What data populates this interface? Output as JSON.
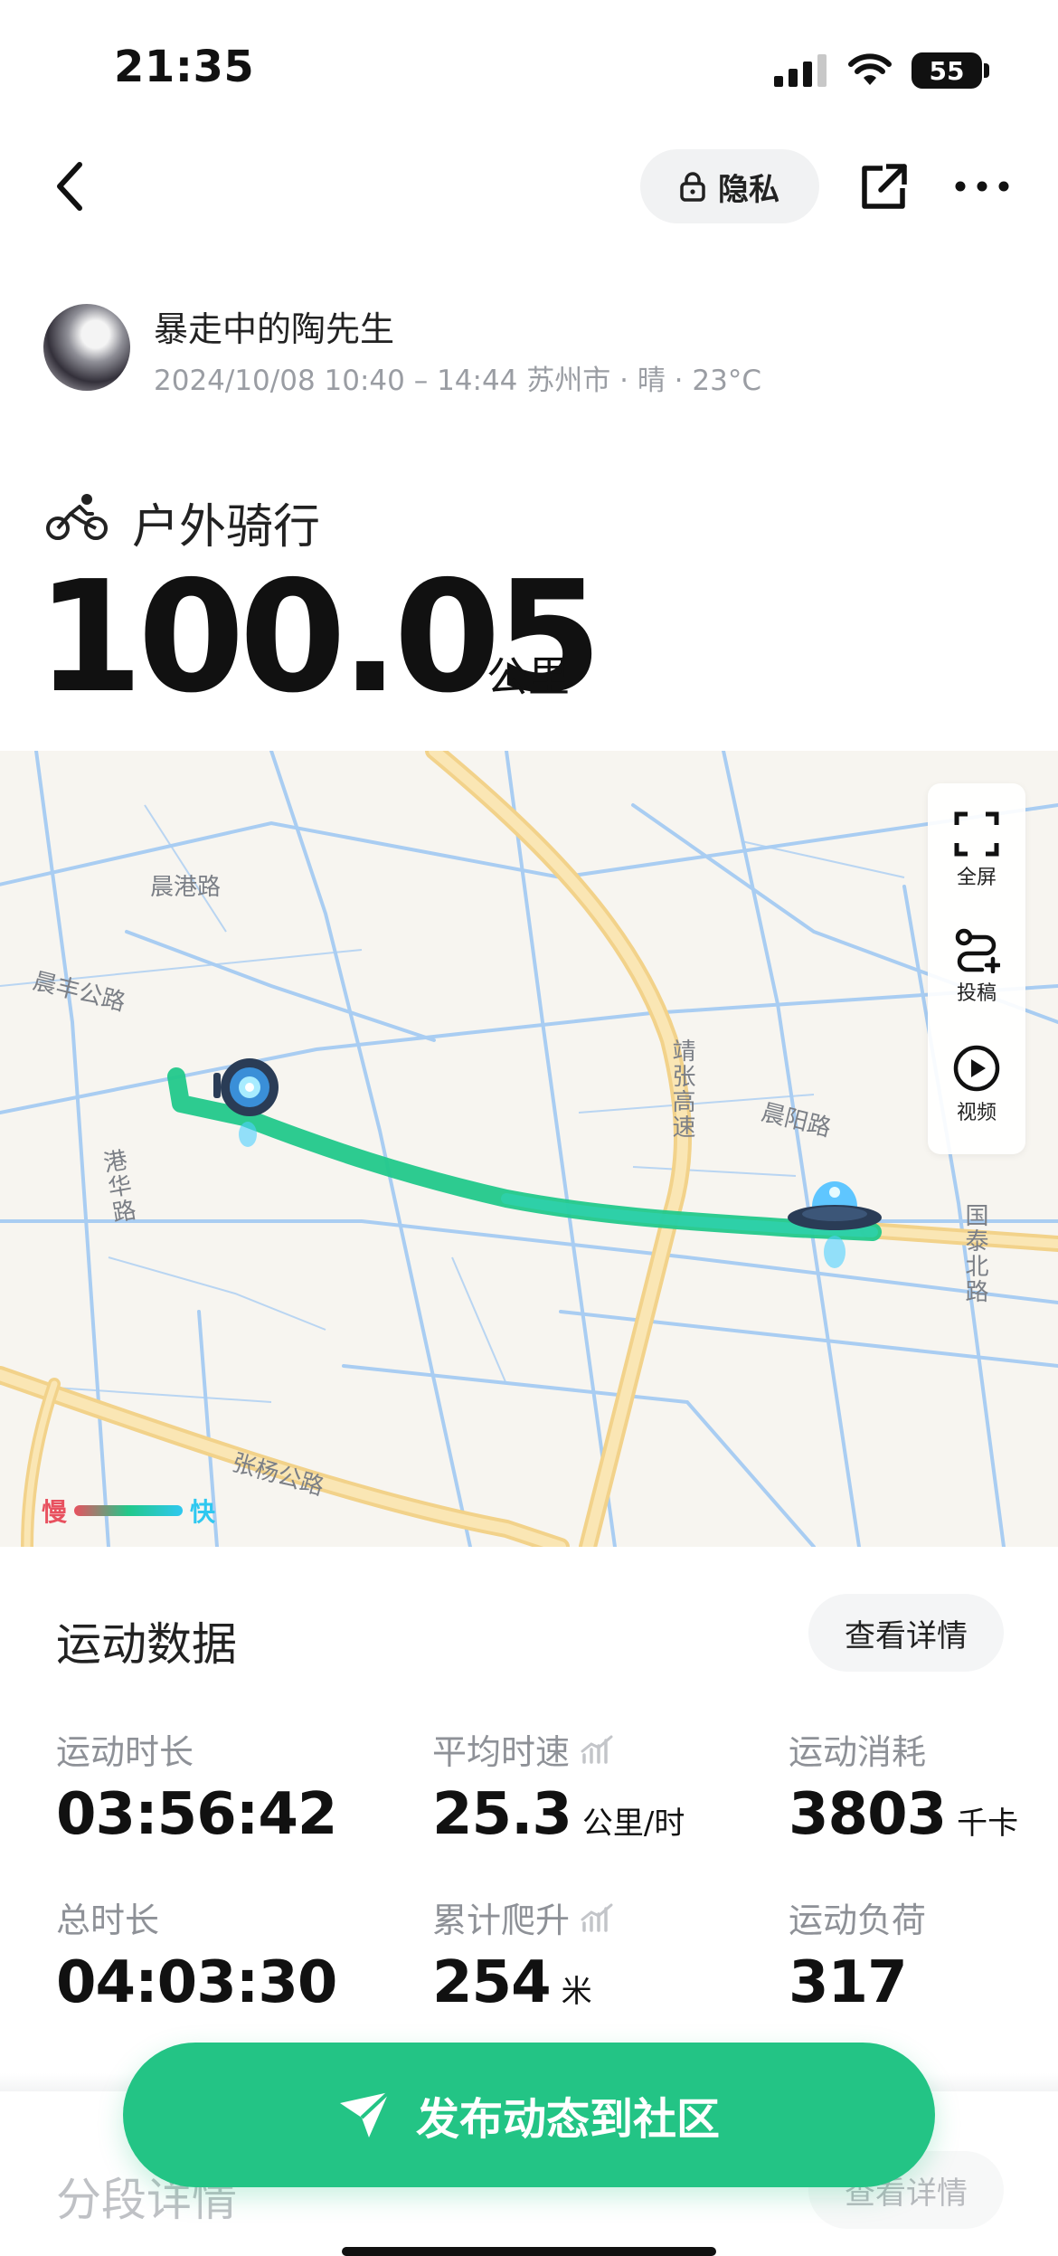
{
  "status_bar": {
    "time": "21:35",
    "battery": "55"
  },
  "nav": {
    "privacy_label": "隐私"
  },
  "header": {
    "username": "暴走中的陶先生",
    "meta": "2024/10/08 10:40 – 14:44 苏州市 · 晴 · 23°C",
    "sport_type": "户外骑行",
    "distance": "100.05",
    "distance_unit": "公里"
  },
  "map": {
    "controls": {
      "fullscreen": "全屏",
      "submit": "投稿",
      "video": "视频"
    },
    "road_labels": {
      "chengang": "晨港路",
      "chenfeng": "晨丰公路",
      "ganghua": "港华路",
      "jingzhang": "靖张高速",
      "chenyang": "晨阳路",
      "guotai": "国泰北路",
      "zhangyang": "张杨公路"
    },
    "legend": {
      "slow": "慢",
      "fast": "快"
    },
    "colors": {
      "route": "#22c88a",
      "route_fast": "#2fd6c0",
      "road_major": "#f7d98c",
      "water": "#a9cdf2"
    }
  },
  "stats": {
    "title": "运动数据",
    "detail_label": "查看详情",
    "items": [
      {
        "label": "运动时长",
        "value": "03:56:42",
        "unit": ""
      },
      {
        "label": "平均时速",
        "value": "25.3",
        "unit": "公里/时"
      },
      {
        "label": "运动消耗",
        "value": "3803",
        "unit": "千卡"
      },
      {
        "label": "总时长",
        "value": "04:03:30",
        "unit": ""
      },
      {
        "label": "累计爬升",
        "value": "254",
        "unit": "米"
      },
      {
        "label": "运动负荷",
        "value": "317",
        "unit": ""
      }
    ]
  },
  "segments": {
    "title": "分段详情",
    "detail_label": "查看详情"
  },
  "publish": {
    "label": "发布动态到社区"
  },
  "accent_color": "#23c485"
}
